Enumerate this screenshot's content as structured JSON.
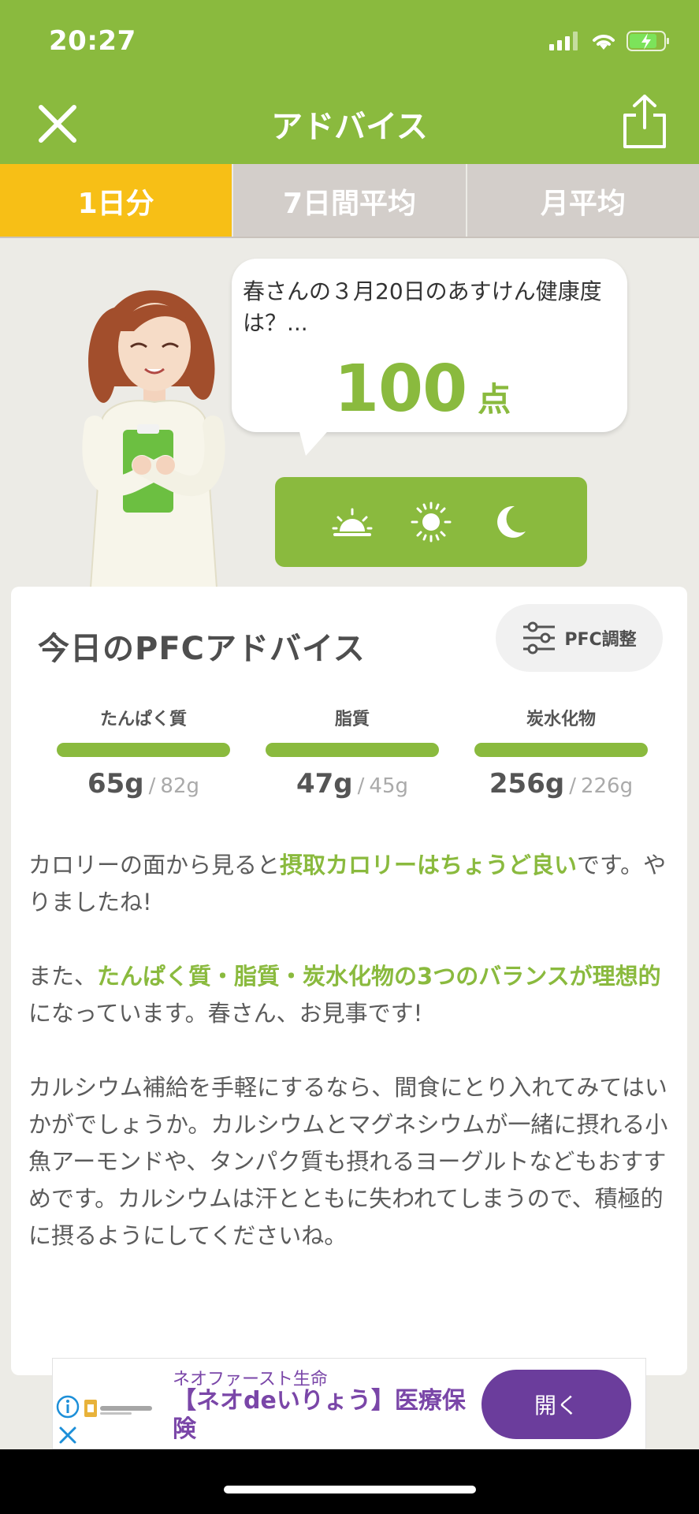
{
  "status_bar": {
    "time": "20:27"
  },
  "nav": {
    "title": "アドバイス"
  },
  "tabs": [
    {
      "label": "1日分",
      "active": true
    },
    {
      "label": "7日間平均",
      "active": false
    },
    {
      "label": "月平均",
      "active": false
    }
  ],
  "bubble": {
    "text": "春さんの３月20日のあすけん健康度は？...",
    "score": "100",
    "score_unit": "点"
  },
  "meal_icons": [
    "sunrise-icon",
    "sun-icon",
    "moon-icon"
  ],
  "card": {
    "title": "今日のPFCアドバイス",
    "pfc_button_label": "PFC調整",
    "nutrients": [
      {
        "label": "たんぱく質",
        "actual": "65g",
        "target": "82g"
      },
      {
        "label": "脂質",
        "actual": "47g",
        "target": "45g"
      },
      {
        "label": "炭水化物",
        "actual": "256g",
        "target": "226g"
      }
    ],
    "separator": "/",
    "advice": {
      "p1_before": "カロリーの面から見ると",
      "p1_highlight": "摂取カロリーはちょうど良い",
      "p1_after": "です。やりましたね!",
      "p2_before": "また、",
      "p2_highlight": "たんぱく質・脂質・炭水化物の3つのバランスが理想的",
      "p2_after": "になっています。春さん、お見事です!",
      "p3": "カルシウム補給を手軽にするなら、間食にとり入れてみてはいかがでしょうか。カルシウムとマグネシウムが一緒に摂れる小魚アーモンドや、タンパク質も摂れるヨーグルトなどもおすすめです。カルシウムは汗とともに失われてしまうので、積極的に摂るようにしてくださいね。"
    }
  },
  "ad": {
    "company": "ネオファースト生命",
    "title": "【ネオdeいりょう】医療保険",
    "open_label": "開く",
    "logo_text": "ネオファースト生命"
  },
  "colors": {
    "brand_green": "#8aba3e",
    "tab_active": "#f7bf16",
    "tab_inactive": "#d3ceca",
    "ad_purple": "#6b3d9c"
  }
}
